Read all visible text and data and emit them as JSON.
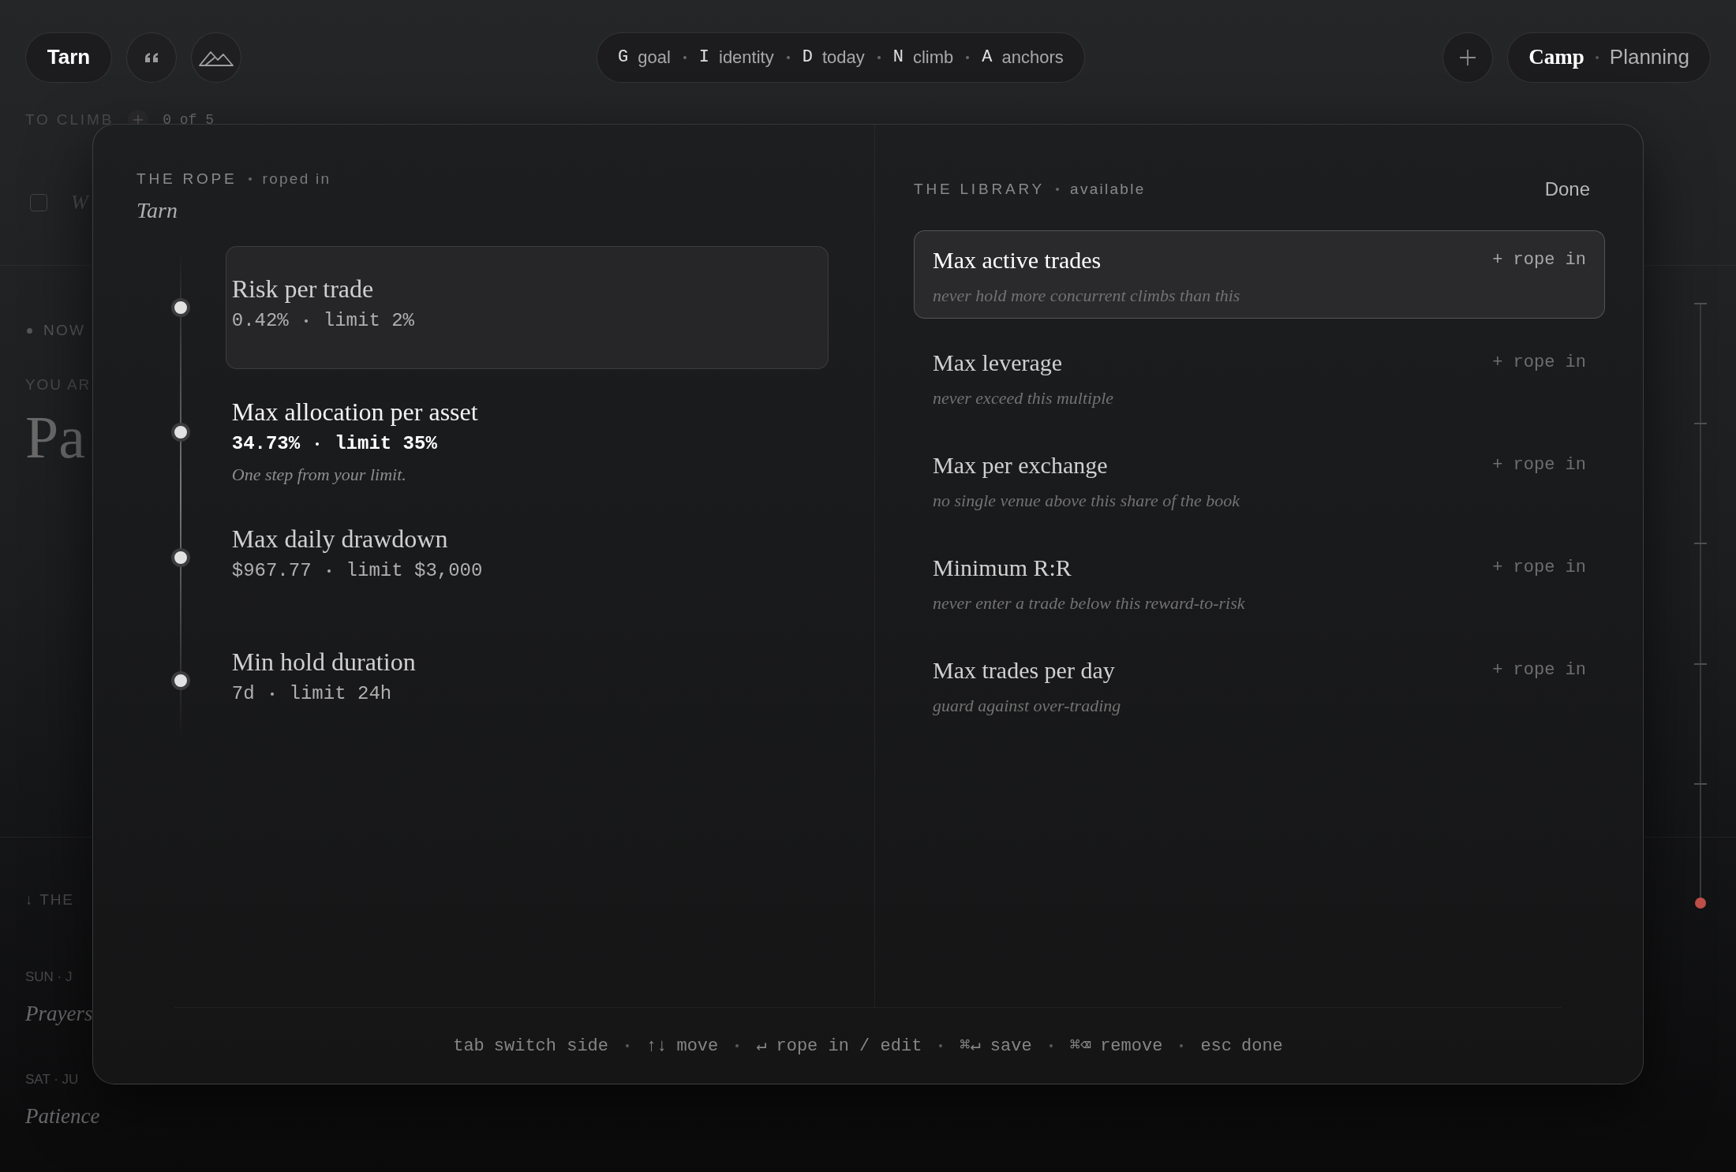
{
  "header": {
    "brand": "Tarn",
    "nav": [
      {
        "key": "G",
        "label": "goal"
      },
      {
        "key": "I",
        "label": "identity"
      },
      {
        "key": "D",
        "label": "today"
      },
      {
        "key": "N",
        "label": "climb"
      },
      {
        "key": "A",
        "label": "anchors"
      }
    ],
    "modes": [
      {
        "label": "Camp",
        "selected": true
      },
      {
        "label": "Planning",
        "selected": false
      }
    ]
  },
  "background": {
    "section_label": "TO CLIMB",
    "count": "0 of 5",
    "task_checked": false,
    "task_initial": "W",
    "now_label": "NOW",
    "you_label": "YOU AR",
    "current_title": "Pa",
    "history_label": "↓ THE",
    "history": [
      {
        "date": "SUN · J",
        "title": "Prayers"
      },
      {
        "date": "SAT · JU",
        "title": "Patience"
      }
    ]
  },
  "rope": {
    "heading": "THE ROPE",
    "status": "roped in",
    "owner": "Tarn",
    "items": [
      {
        "title": "Risk per trade",
        "value": "0.42%",
        "limit": "limit 2%",
        "selected": true,
        "near_limit": false
      },
      {
        "title": "Max allocation per asset",
        "value": "34.73%",
        "limit": "limit 35%",
        "note": "One step from your limit.",
        "selected": false,
        "near_limit": true
      },
      {
        "title": "Max daily drawdown",
        "value": "$967.77",
        "limit": "limit $3,000",
        "selected": false,
        "near_limit": false
      },
      {
        "title": "Min hold duration",
        "value": "7d",
        "limit": "limit 24h",
        "selected": false,
        "near_limit": false
      }
    ]
  },
  "library": {
    "heading": "THE LIBRARY",
    "status": "available",
    "done": "Done",
    "items": [
      {
        "title": "Max active trades",
        "description": "never hold more concurrent climbs than this",
        "action": "+ rope in",
        "selected": true
      },
      {
        "title": "Max leverage",
        "description": "never exceed this multiple",
        "action": "+ rope in",
        "selected": false
      },
      {
        "title": "Max per exchange",
        "description": "no single venue above this share of the book",
        "action": "+ rope in",
        "selected": false
      },
      {
        "title": "Minimum R:R",
        "description": "never enter a trade below this reward-to-risk",
        "action": "+ rope in",
        "selected": false
      },
      {
        "title": "Max trades per day",
        "description": "guard against over-trading",
        "action": "+ rope in",
        "selected": false
      }
    ]
  },
  "hints": [
    {
      "key": "tab",
      "label": "switch side"
    },
    {
      "key": "↑↓",
      "label": "move"
    },
    {
      "key": "↵",
      "label": "rope in / edit"
    },
    {
      "key": "⌘↵",
      "label": "save"
    },
    {
      "key": "⌘⌫",
      "label": "remove"
    },
    {
      "key": "esc",
      "label": "done"
    }
  ]
}
